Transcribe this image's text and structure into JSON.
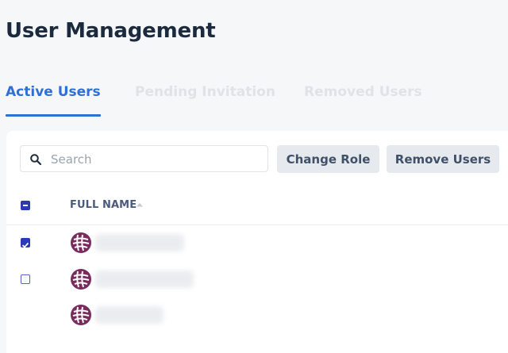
{
  "header": {
    "title": "User Management"
  },
  "tabs": [
    {
      "label": "Active Users",
      "active": true
    },
    {
      "label": "Pending Invitation",
      "active": false
    },
    {
      "label": "Removed Users",
      "active": false
    }
  ],
  "toolbar": {
    "search_placeholder": "Search",
    "change_role_label": "Change Role",
    "remove_users_label": "Remove Users"
  },
  "table": {
    "columns": [
      {
        "label": "FULL NAME",
        "sort": "ascending"
      }
    ],
    "select_all_state": "indeterminate",
    "rows": [
      {
        "checked": true
      },
      {
        "checked": false
      },
      {
        "checked": null
      }
    ]
  },
  "colors": {
    "accent": "#2f6fd6",
    "checkbox": "#2c3bb5",
    "avatar": "#7a2b5e",
    "title": "#1b2a3f"
  }
}
